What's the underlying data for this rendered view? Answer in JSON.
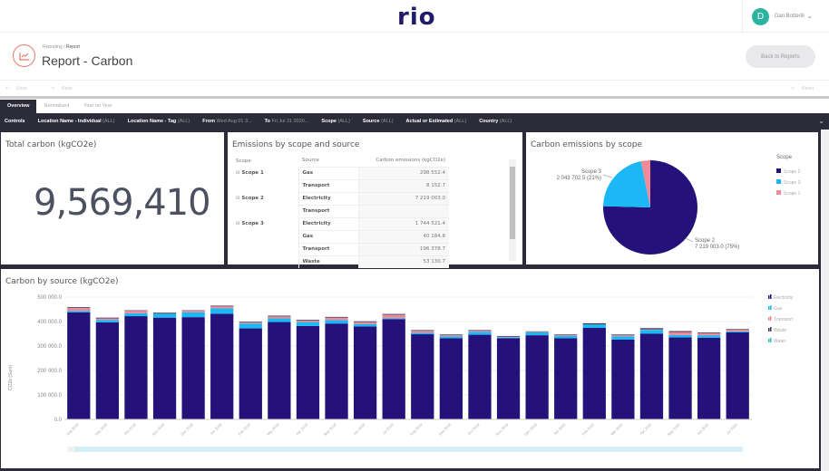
{
  "topbar": {
    "logo": "rio",
    "user_initial": "D",
    "user_name": "Dan Botterill",
    "chevron": "⌄"
  },
  "header": {
    "breadcrumb": [
      "Reporting",
      "Report"
    ],
    "title": "Report - Carbon",
    "back_button": "Back to Reports"
  },
  "toolbar": {
    "undo": "Undo",
    "redo": "Redo",
    "reset": "Reset"
  },
  "tabs": [
    {
      "label": "Overview",
      "active": true
    },
    {
      "label": "Normalised",
      "active": false
    },
    {
      "label": "Year on Year",
      "active": false
    }
  ],
  "controls": {
    "label": "Controls",
    "filters": [
      {
        "name": "Location Name - Individual",
        "value": "(ALL)"
      },
      {
        "name": "Location Name - Tag",
        "value": "(ALL)"
      },
      {
        "name": "From",
        "value": "Wed Aug 01 3..."
      },
      {
        "name": "To",
        "value": "Fri Jul 31 2020..."
      },
      {
        "name": "Scope",
        "value": "(ALL)"
      },
      {
        "name": "Source",
        "value": "(ALL)"
      },
      {
        "name": "Actual or Estimated",
        "value": "(ALL)"
      },
      {
        "name": "Country",
        "value": "(ALL)"
      }
    ]
  },
  "total_panel": {
    "title": "Total carbon (kgCO2e)",
    "value": "9,569,410"
  },
  "table_panel": {
    "title": "Emissions by scope and source",
    "headers": [
      "Scope",
      "Source",
      "Carbon emissions (kgCO2e)"
    ],
    "rows": [
      {
        "scope": "Scope 1",
        "source": "Gas",
        "value": "298 552.4"
      },
      {
        "scope": "",
        "source": "Transport",
        "value": "8 152.7"
      },
      {
        "scope": "Scope 2",
        "source": "Electricity",
        "value": "7 219 003.0"
      },
      {
        "scope": "",
        "source": "Transport",
        "value": ""
      },
      {
        "scope": "Scope 3",
        "source": "Electricity",
        "value": "1 744 521.4"
      },
      {
        "scope": "",
        "source": "Gas",
        "value": "40 184.8"
      },
      {
        "scope": "",
        "source": "Transport",
        "value": "196 378.7"
      },
      {
        "scope": "",
        "source": "Waste",
        "value": "53 130.7"
      }
    ]
  },
  "chart_data": [
    {
      "type": "pie",
      "title": "Carbon emissions by scope",
      "legend_title": "Scope",
      "legend_position": "right",
      "slices": [
        {
          "label": "Scope 2",
          "value": 7219003.0,
          "percent": 75,
          "color": "#24117a",
          "annotation": "7 219 003.0 (75%)"
        },
        {
          "label": "Scope 3",
          "value": 2043702.5,
          "percent": 21,
          "color": "#1cb8f5",
          "annotation": "2 043 702.5 (21%)"
        },
        {
          "label": "Scope 1",
          "value": 306705.1,
          "percent": 3,
          "color": "#f08a96",
          "annotation": ""
        }
      ]
    },
    {
      "type": "bar",
      "stacked": true,
      "title": "Carbon by source (kgCO2e)",
      "ylabel": "CO2e (Sum)",
      "ylim": [
        0,
        500000
      ],
      "yticks": [
        "0.0",
        "100 000.0",
        "200 000.0",
        "300 000.0",
        "400 000.0",
        "500 000.0"
      ],
      "legend_position": "right",
      "categories": [
        "Aug 2018",
        "Sep 2018",
        "Oct 2018",
        "Nov 2018",
        "Dec 2018",
        "Jan 2019",
        "Feb 2019",
        "Mar 2019",
        "Apr 2019",
        "May 2019",
        "Jun 2019",
        "Jul 2019",
        "Aug 2019",
        "Sep 2019",
        "Oct 2019",
        "Nov 2019",
        "Dec 2019",
        "Jan 2020",
        "Feb 2020",
        "Mar 2020",
        "Apr 2020",
        "May 2020",
        "Jun 2020",
        "Jul 2020"
      ],
      "series": [
        {
          "name": "Electricity",
          "color": "#24117a",
          "values": [
            438000,
            397000,
            422000,
            416000,
            418000,
            432000,
            372000,
            398000,
            382000,
            392000,
            380000,
            410000,
            348000,
            332000,
            346000,
            332000,
            344000,
            332000,
            374000,
            326000,
            350000,
            335000,
            334000,
            356000
          ]
        },
        {
          "name": "Gas",
          "color": "#1cb8f5",
          "values": [
            6000,
            10000,
            12000,
            16000,
            20000,
            22000,
            20000,
            15000,
            16000,
            14000,
            10000,
            4000,
            6000,
            8000,
            12000,
            4000,
            12000,
            10000,
            14000,
            14000,
            16000,
            10000,
            10000,
            4000
          ]
        },
        {
          "name": "Transport",
          "color": "#f08a96",
          "values": [
            12000,
            6000,
            10000,
            0,
            6000,
            8000,
            4000,
            8000,
            6000,
            10000,
            8000,
            14000,
            8000,
            4000,
            4000,
            2000,
            2000,
            4000,
            0,
            4000,
            2000,
            12000,
            8000,
            6000
          ]
        },
        {
          "name": "Waste",
          "color": "#3a3a5c",
          "values": [
            3000,
            3000,
            2000,
            4000,
            2000,
            3000,
            3000,
            3000,
            3000,
            3000,
            3000,
            3000,
            3000,
            3000,
            3000,
            3000,
            2000,
            2000,
            5000,
            3000,
            5000,
            4000,
            3000,
            3000
          ]
        },
        {
          "name": "Water",
          "color": "#2ec4a8",
          "values": [
            0,
            0,
            0,
            0,
            0,
            0,
            0,
            0,
            0,
            0,
            0,
            0,
            0,
            0,
            0,
            0,
            0,
            0,
            0,
            0,
            0,
            0,
            0,
            0
          ]
        }
      ]
    }
  ]
}
